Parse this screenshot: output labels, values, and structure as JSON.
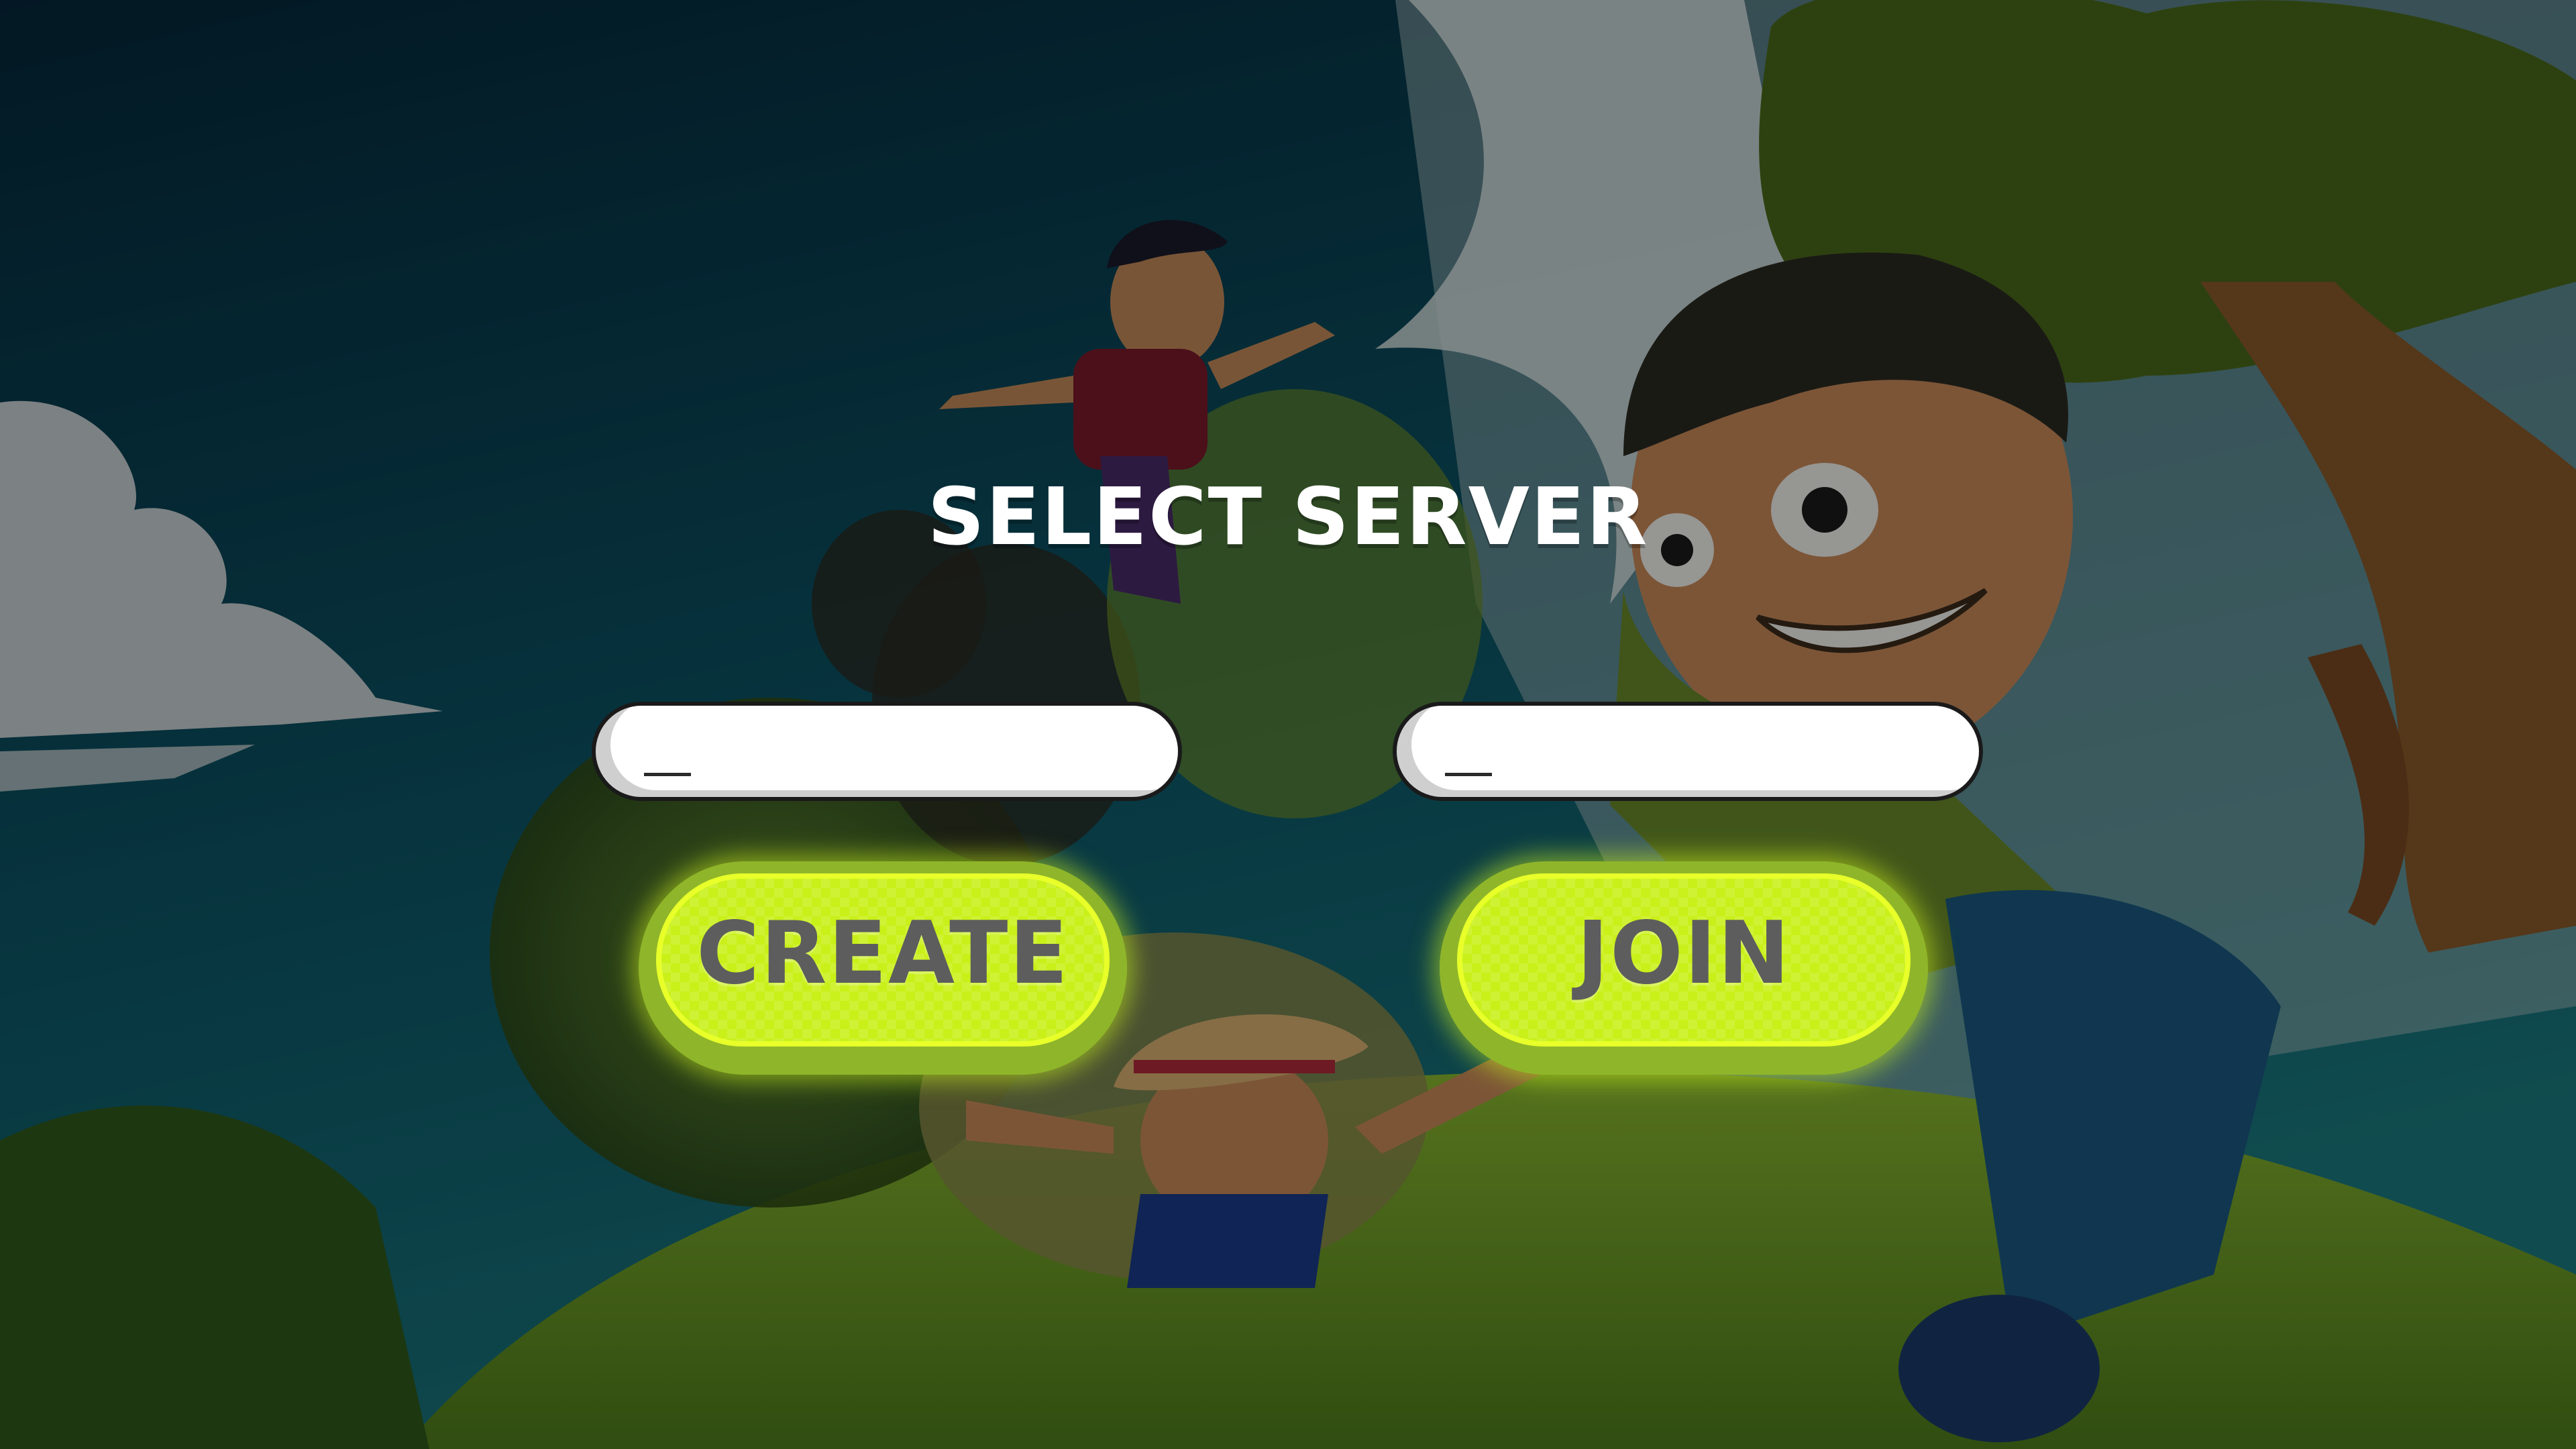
{
  "screen": {
    "title": "SELECT SERVER"
  },
  "inputs": {
    "left": {
      "value": "",
      "placeholder": ""
    },
    "right": {
      "value": "",
      "placeholder": ""
    }
  },
  "buttons": {
    "create_label": "CREATE",
    "join_label": "JOIN"
  },
  "colors": {
    "title_text": "#ffffff",
    "button_face": "#c9f019",
    "button_glow": "#e8ff2a",
    "button_text": "#5d5d5d",
    "input_bg": "#ffffff",
    "input_border": "#1a1a1a",
    "sky_top": "#05283a",
    "sky_bottom": "#0f6a7a",
    "grass": "#a8c632"
  },
  "background": {
    "icons": [
      "cartoon-boy-jumping",
      "cartoon-boy-grinning",
      "cartoon-boy-with-hat",
      "tree",
      "clouds",
      "grass-hill"
    ]
  }
}
